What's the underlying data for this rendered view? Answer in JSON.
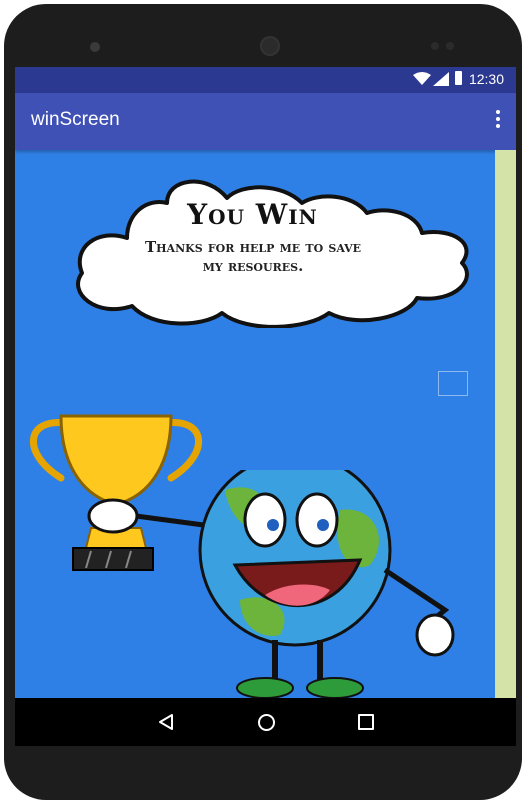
{
  "status_bar": {
    "time": "12:30",
    "icons": [
      "wifi-icon",
      "signal-icon",
      "battery-icon"
    ]
  },
  "app_bar": {
    "title": "winScreen",
    "menu_icon": "overflow-menu-icon"
  },
  "cloud": {
    "title": "You Win",
    "message_line1": "Thanks for help me to save",
    "message_line2": "my resoures."
  },
  "nav_bar": {
    "icons": [
      "back-icon",
      "home-icon",
      "recent-apps-icon"
    ]
  },
  "colors": {
    "status_bar": "#2b3990",
    "app_bar": "#3f51b5",
    "background": "#2f80e6",
    "side_strip": "#d4e3a8",
    "device": "#1d1d1d"
  }
}
